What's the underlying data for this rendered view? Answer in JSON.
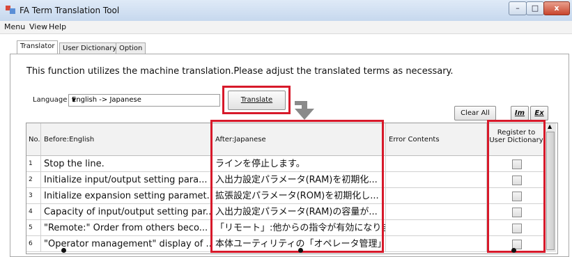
{
  "window": {
    "title": "FA Term Translation Tool",
    "controls": {
      "minimize": "–",
      "maximize": "□",
      "close": "x"
    }
  },
  "menu": [
    "Menu",
    "View",
    "Help"
  ],
  "tabs": [
    "Translator",
    "User Dictionary",
    "Option"
  ],
  "description": "This function utilizes the machine translation.Please adjust the translated terms as necessary.",
  "language": {
    "label": "Language",
    "value": "English -> Japanese"
  },
  "buttons": {
    "translate": "Translate",
    "clear_all": "Clear All",
    "im": "Im",
    "ex": "Ex"
  },
  "table": {
    "headers": {
      "no": "No.",
      "before": "Before:English",
      "after": "After:Japanese",
      "error": "Error Contents",
      "register_line1": "Register to",
      "register_line2": "User Dictionary"
    },
    "rows": [
      {
        "no": "1",
        "before": "Stop the line.",
        "after": "ラインを停止します。",
        "error": ""
      },
      {
        "no": "2",
        "before": "Initialize input/output setting para...",
        "after": "入出力設定パラメータ(RAM)を初期化...",
        "error": ""
      },
      {
        "no": "3",
        "before": "Initialize expansion setting paramet...",
        "after": "拡張設定パラメータ(ROM)を初期化し...",
        "error": ""
      },
      {
        "no": "4",
        "before": "Capacity of input/output setting par...",
        "after": "入出力設定パラメータ(RAM)の容量が...",
        "error": ""
      },
      {
        "no": "5",
        "before": "\"Remote:\" Order from others beco...",
        "after": "「リモート」:他からの指令が有効になりま...",
        "error": ""
      },
      {
        "no": "6",
        "before": "\"Operator management\" display of ...",
        "after": "本体ユーティリティの「オペレータ管理」表...",
        "error": ""
      }
    ]
  },
  "colors": {
    "highlight": "#d7192a",
    "arrow": "#8a8a8a"
  }
}
